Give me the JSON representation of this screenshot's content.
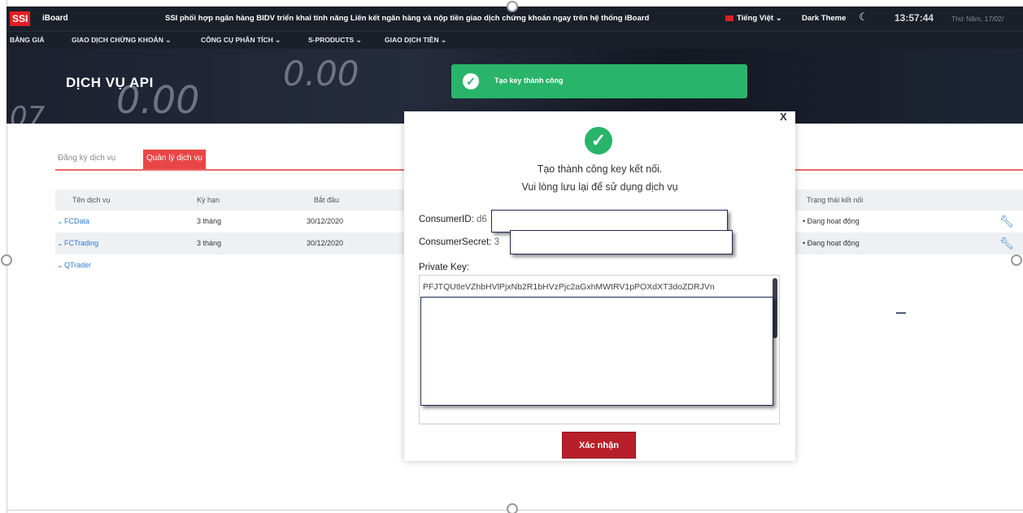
{
  "topbar": {
    "logo": "SSI",
    "brand": "iBoard",
    "ticker": "SSI phối hợp ngân hàng BIDV triển khai tính năng Liên kết ngân hàng và nộp tiền giao dịch chứng khoán ngay trên hệ thống iBoard",
    "language": "Tiếng Việt",
    "theme": "Dark Theme",
    "clock": "13:57:44",
    "date": "Thứ Năm, 17/02/"
  },
  "nav": {
    "items": [
      "BẢNG GIÁ",
      "GIAO DỊCH CHỨNG KHOÁN",
      "CÔNG CỤ PHÂN TÍCH",
      "S-PRODUCTS",
      "GIAO DỊCH TIỀN"
    ]
  },
  "banner": {
    "title": "DỊCH VỤ API",
    "bg_numbers": [
      "0.00",
      "0.00",
      "07"
    ]
  },
  "toast": {
    "message": "Tạo key thành công"
  },
  "tabs": [
    {
      "label": "Đăng ký dịch vụ",
      "active": false
    },
    {
      "label": "Quản lý dịch vụ",
      "active": true
    }
  ],
  "table": {
    "headers": [
      "Tên dịch vụ",
      "Kỳ hạn",
      "Bắt đầu",
      "Trạng thái kết nối"
    ],
    "rows": [
      {
        "name": "FCData",
        "term": "3 tháng",
        "start": "30/12/2020",
        "status": "Đang hoạt động"
      },
      {
        "name": "FCTrading",
        "term": "3 tháng",
        "start": "30/12/2020",
        "status": "Đang hoạt động"
      },
      {
        "name": "QTrader",
        "term": "",
        "start": "",
        "status": ""
      }
    ]
  },
  "modal": {
    "close": "X",
    "line1": "Tạo thành công key kết nối.",
    "line2": "Vui lòng lưu lại để sử dụng dịch vụ",
    "consumer_id_label": "ConsumerID:",
    "consumer_id_peek": "d6",
    "consumer_secret_label": "ConsumerSecret:",
    "consumer_secret_peek": "3",
    "private_key_label": "Private Key:",
    "private_key_value": "PFJTQUtleVZhbHVlPjxNb2R1bHVzPjc2aGxhMWtRV1pPOXdXT3doZDRJVn",
    "confirm_label": "Xác nhận"
  },
  "colors": {
    "brand_red": "#e31e24",
    "toast_green": "#29b46a",
    "confirm_red": "#b81f2a",
    "link_blue": "#2f7ad6",
    "dark_bar": "#1b1f2a"
  }
}
